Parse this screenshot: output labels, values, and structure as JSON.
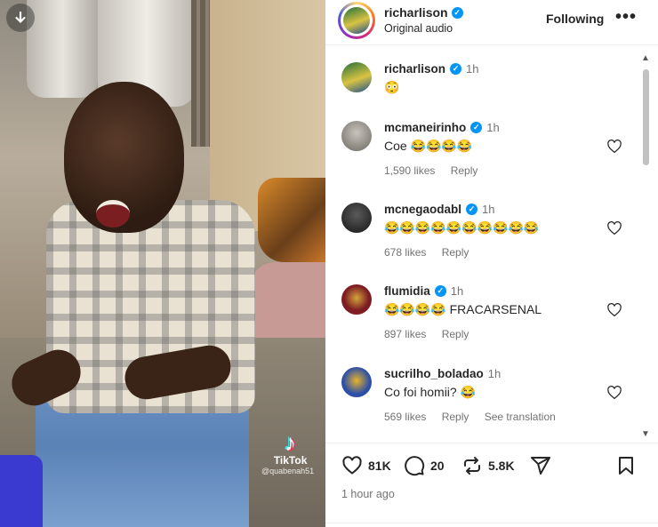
{
  "post": {
    "username": "richarlison",
    "audio": "Original audio",
    "follow_label": "Following",
    "more_label": "•••",
    "caption_time": "1h",
    "caption_text": "😳"
  },
  "comments": [
    {
      "username": "mcmaneirinho",
      "time": "1h",
      "text": "Coe 😂😂😂😂",
      "likes": "1,590 likes",
      "reply": "Reply"
    },
    {
      "username": "mcnegaodabl",
      "time": "1h",
      "text": "😂😂😂😂😂😂😂😂😂😂",
      "likes": "678 likes",
      "reply": "Reply"
    },
    {
      "username": "flumidia",
      "time": "1h",
      "text": "😂😂😂😂 FRACARSENAL",
      "likes": "897 likes",
      "reply": "Reply"
    },
    {
      "username": "sucrilho_boladao",
      "time": "1h",
      "text": "Co foi homii? 😂",
      "likes": "569 likes",
      "reply": "Reply",
      "translate": "See translation"
    }
  ],
  "stats": {
    "likes": "81K",
    "comments": "20",
    "reposts": "5.8K",
    "posted": "1 hour ago"
  },
  "media": {
    "watermark_brand": "TikTok",
    "watermark_handle": "@quabenah51"
  }
}
